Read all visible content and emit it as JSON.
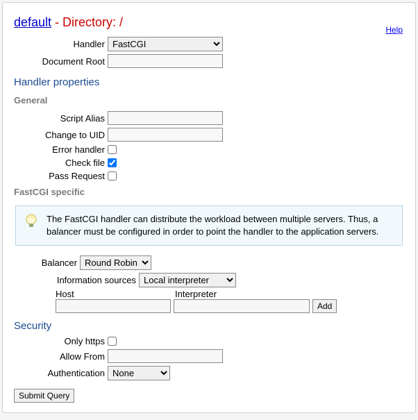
{
  "header": {
    "breadcrumb_link": "default",
    "directory_text": " - Directory: /",
    "help_label": "Help"
  },
  "top": {
    "handler_label": "Handler",
    "handler_value": "FastCGI",
    "docroot_label": "Document Root",
    "docroot_value": ""
  },
  "handler_props": {
    "title": "Handler properties",
    "general_title": "General",
    "script_alias_label": "Script Alias",
    "script_alias_value": "",
    "change_uid_label": "Change to UID",
    "change_uid_value": "",
    "error_handler_label": "Error handler",
    "check_file_label": "Check file",
    "pass_request_label": "Pass Request",
    "fastcgi_title": "FastCGI specific",
    "tip_text": "The FastCGI handler can distribute the workload between multiple servers. Thus, a balancer must be configured in order to point the handler to the application servers.",
    "balancer_label": "Balancer",
    "balancer_value": "Round Robin",
    "infosrc_label": "Information sources",
    "infosrc_value": "Local interpreter",
    "host_label": "Host",
    "host_value": "",
    "interpreter_label": "Interpreter",
    "interpreter_value": "",
    "add_label": "Add"
  },
  "security": {
    "title": "Security",
    "only_https_label": "Only https",
    "allow_from_label": "Allow From",
    "allow_from_value": "",
    "auth_label": "Authentication",
    "auth_value": "None"
  },
  "submit_label": "Submit Query"
}
